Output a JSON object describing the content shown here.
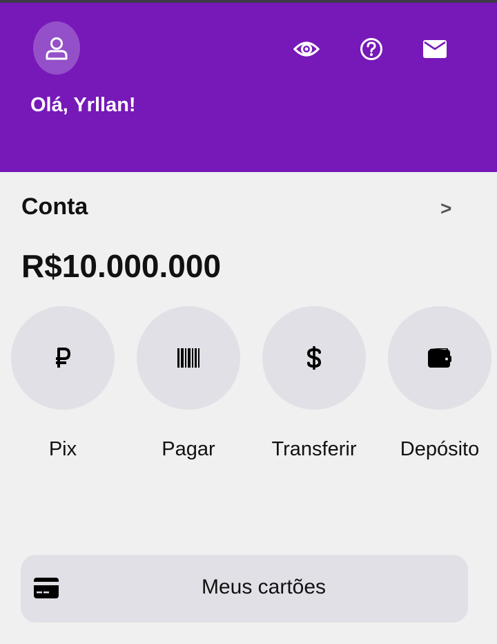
{
  "header": {
    "greeting": "Olá, Yrllan!",
    "background_color": "#7718b8",
    "icons": [
      "user-icon",
      "eye-icon",
      "help-icon",
      "mail-icon"
    ]
  },
  "account": {
    "title": "Conta",
    "arrow": ">",
    "balance": "R$10.000.000"
  },
  "actions": [
    {
      "label": "Pix",
      "icon": "ruble-sign-icon"
    },
    {
      "label": "Pagar",
      "icon": "barcode-icon"
    },
    {
      "label": "Transferir",
      "icon": "dollar-sign-icon"
    },
    {
      "label": "Depósito",
      "icon": "wallet-icon"
    }
  ],
  "cards": {
    "label": "Meus cartões",
    "icon": "credit-card-icon"
  }
}
